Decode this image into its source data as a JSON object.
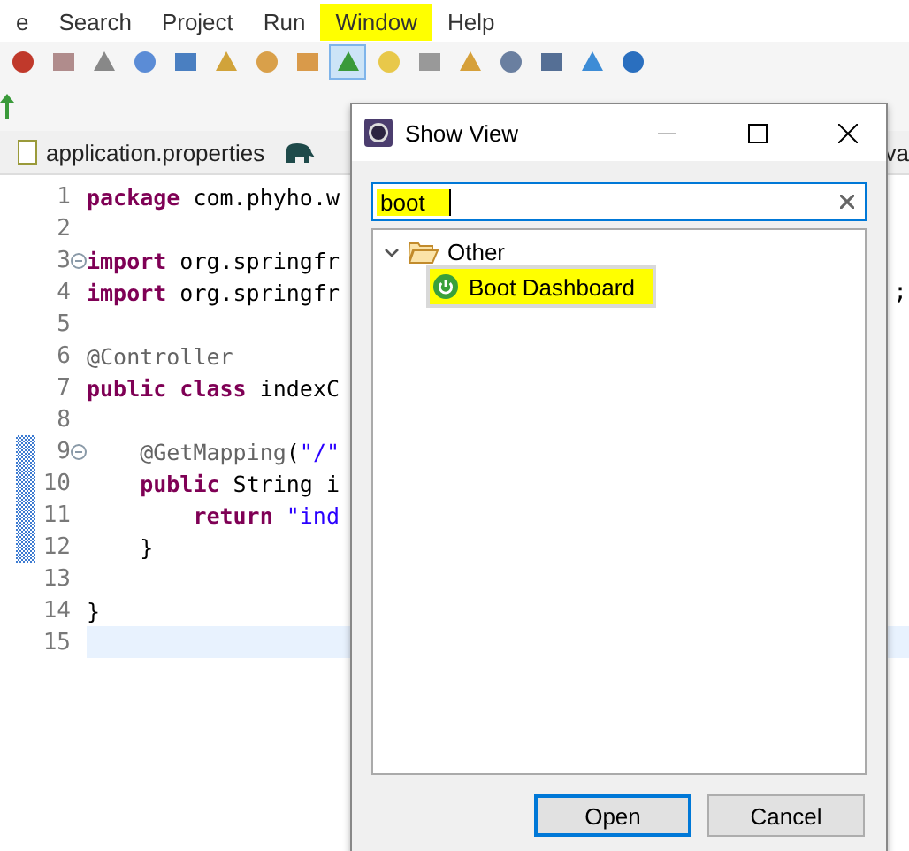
{
  "menu": [
    {
      "label": "e",
      "highlighted": false
    },
    {
      "label": "Search",
      "highlighted": false
    },
    {
      "label": "Project",
      "highlighted": false
    },
    {
      "label": "Run",
      "highlighted": false
    },
    {
      "label": "Window",
      "highlighted": true
    },
    {
      "label": "Help",
      "highlighted": false
    }
  ],
  "toolbar": [
    {
      "pressed": false
    },
    {
      "pressed": false
    },
    {
      "pressed": false
    },
    {
      "pressed": false
    },
    {
      "pressed": false
    },
    {
      "pressed": false
    },
    {
      "pressed": false
    },
    {
      "pressed": false
    },
    {
      "pressed": true
    },
    {
      "pressed": false
    },
    {
      "pressed": false
    },
    {
      "pressed": false
    },
    {
      "pressed": false
    },
    {
      "pressed": false
    },
    {
      "pressed": false
    },
    {
      "pressed": false
    }
  ],
  "editor_tabs": [
    {
      "label": "application.properties"
    },
    {
      "label": "va"
    }
  ],
  "code_lines": [
    {
      "number": "1",
      "tokens": [
        {
          "kind": "keyword",
          "text": "package"
        },
        {
          "kind": "plain",
          "text": " com.phyho.w"
        }
      ]
    },
    {
      "number": "2"
    },
    {
      "number": "3",
      "folded": true,
      "tokens": [
        {
          "kind": "keyword",
          "text": "import"
        },
        {
          "kind": "plain",
          "text": " org.springfr"
        }
      ]
    },
    {
      "number": "4",
      "tokens": [
        {
          "kind": "keyword",
          "text": "import"
        },
        {
          "kind": "plain",
          "text": " org.springfr"
        }
      ],
      "tail": ";"
    },
    {
      "number": "5"
    },
    {
      "number": "6",
      "tokens": [
        {
          "kind": "annotation",
          "text": "@Controller"
        }
      ]
    },
    {
      "number": "7",
      "tokens": [
        {
          "kind": "keyword",
          "text": "public"
        },
        {
          "kind": "keyword",
          "text": " class"
        },
        {
          "kind": "plain",
          "text": " indexC"
        }
      ]
    },
    {
      "number": "8"
    },
    {
      "number": "9",
      "folded": true,
      "changed": true,
      "tokens": [
        {
          "kind": "annotation",
          "text": "    @GetMapping"
        },
        {
          "kind": "plain",
          "text": "("
        },
        {
          "kind": "string",
          "text": "\"/\""
        }
      ]
    },
    {
      "number": "10",
      "changed": true,
      "tokens": [
        {
          "kind": "keyword",
          "text": "    public"
        },
        {
          "kind": "plain",
          "text": " String i"
        }
      ]
    },
    {
      "number": "11",
      "changed": true,
      "tokens": [
        {
          "kind": "keyword",
          "text": "        return"
        },
        {
          "kind": "string",
          "text": " \"ind"
        }
      ]
    },
    {
      "number": "12",
      "changed": true,
      "tokens": [
        {
          "kind": "plain",
          "text": "    }"
        }
      ]
    },
    {
      "number": "13"
    },
    {
      "number": "14",
      "tokens": [
        {
          "kind": "plain",
          "text": "}"
        }
      ]
    },
    {
      "number": "15",
      "current": true
    }
  ],
  "dialog": {
    "title": "Show View",
    "search": {
      "value": "boot",
      "highlighted": true
    },
    "tree": [
      {
        "label": "Other",
        "expanded": true,
        "children": [
          {
            "label": "Boot Dashboard",
            "selected": true,
            "highlighted": true
          }
        ]
      }
    ],
    "buttons": [
      {
        "label": "Open",
        "default": true
      },
      {
        "label": "Cancel",
        "default": false
      }
    ]
  }
}
